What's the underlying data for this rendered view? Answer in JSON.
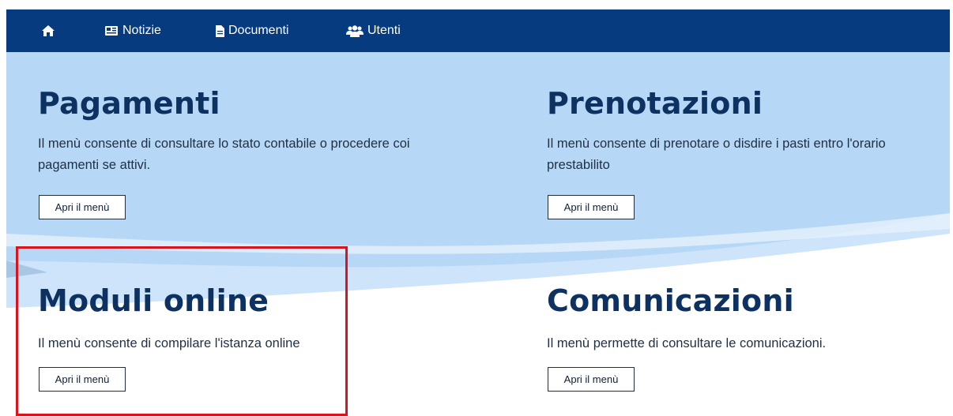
{
  "nav": {
    "home_icon": "home-icon",
    "items": [
      {
        "label": "Notizie",
        "icon": "newspaper-icon"
      },
      {
        "label": "Documenti",
        "icon": "file-icon"
      },
      {
        "label": "Utenti",
        "icon": "users-icon"
      }
    ]
  },
  "colors": {
    "nav_bg": "#073b80",
    "heading": "#0d3161",
    "hero_bg": "#b4d6f5",
    "highlight": "#d8141f"
  },
  "cards": [
    {
      "title": "Pagamenti",
      "description": "Il menù consente di consultare lo stato contabile o procedere coi pagamenti se attivi.",
      "button": "Apri il menù"
    },
    {
      "title": "Prenotazioni",
      "description": "Il menù consente di prenotare o disdire i pasti entro l'orario prestabilito",
      "button": "Apri il menù"
    },
    {
      "title": "Moduli online",
      "description": "Il menù consente di compilare l'istanza online",
      "button": "Apri il menù"
    },
    {
      "title": "Comunicazioni",
      "description": "Il menù permette di consultare le comunicazioni.",
      "button": "Apri il menù"
    }
  ]
}
